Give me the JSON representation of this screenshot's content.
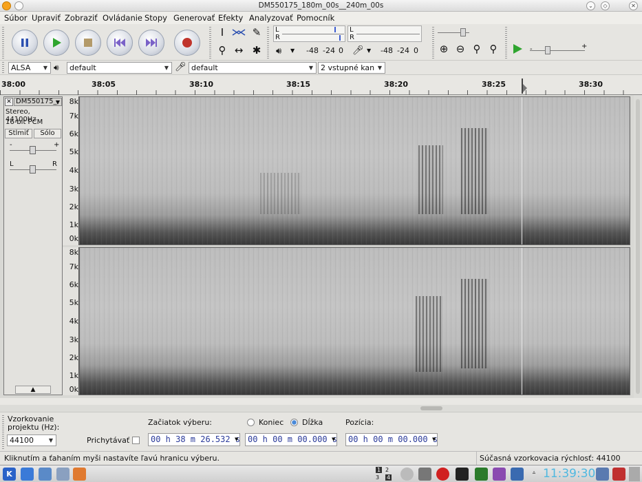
{
  "window": {
    "title": "DM550175_180m_00s__240m_00s"
  },
  "menu": [
    "Súbor",
    "Upraviť",
    "Zobraziť",
    "Ovládanie",
    "Stopy",
    "Generovať",
    "Efekty",
    "Analyzovať",
    "Pomocník"
  ],
  "transport": {
    "pause": "pause-icon",
    "play": "play-icon",
    "stop": "stop-icon",
    "skip_start": "skip-start-icon",
    "skip_end": "skip-end-icon",
    "record": "record-icon"
  },
  "meters": {
    "play_L": "L",
    "play_R": "R",
    "rec_L": "L",
    "rec_R": "R",
    "play_scale": [
      "-48",
      "-24",
      "0"
    ],
    "rec_scale": [
      "-48",
      "-24",
      "0"
    ]
  },
  "device": {
    "host": "ALSA",
    "output": "default",
    "input": "default",
    "channels": "2 vstupné kan"
  },
  "ruler": [
    "38:00",
    "38:05",
    "38:10",
    "38:15",
    "38:20",
    "38:25",
    "38:30"
  ],
  "track": {
    "name": "DM550175_",
    "format_rate": "Stereo, 44100Hz",
    "format_bits": "16-bit PCM",
    "mute": "Stlmiť",
    "solo": "Sólo",
    "gain_minus": "-",
    "gain_plus": "+",
    "pan_left": "L",
    "pan_right": "R"
  },
  "freq_labels": [
    "8k",
    "7k",
    "6k",
    "5k",
    "4k",
    "3k",
    "2k",
    "1k",
    "0k"
  ],
  "selection": {
    "rate_label_1": "Vzorkovanie",
    "rate_label_2": "projektu (Hz):",
    "rate_value": "44100",
    "snap_label": "Prichytávať",
    "start_label": "Začiatok výberu:",
    "end_label": "Koniec",
    "length_label": "Dĺžka",
    "position_label": "Pozícia:",
    "start_time": "00 h 38 m 26.532 s",
    "length_time": "00 h 00 m 00.000 s",
    "position_time": "00 h 00 m 00.000 s"
  },
  "status": {
    "hint": "Kliknutím a ťahaním myši nastavíte ľavú hranicu výberu.",
    "rate": "Súčasná vzorkovacia rýchlosť: 44100"
  },
  "taskbar": {
    "clock": "11:39:30",
    "desktops": [
      "1",
      "2",
      "3",
      "4"
    ]
  },
  "colors": {
    "accent": "#2a3a9a",
    "play_green": "#2fa52f",
    "record_red": "#c0342c",
    "clock": "#4fb8e0"
  }
}
